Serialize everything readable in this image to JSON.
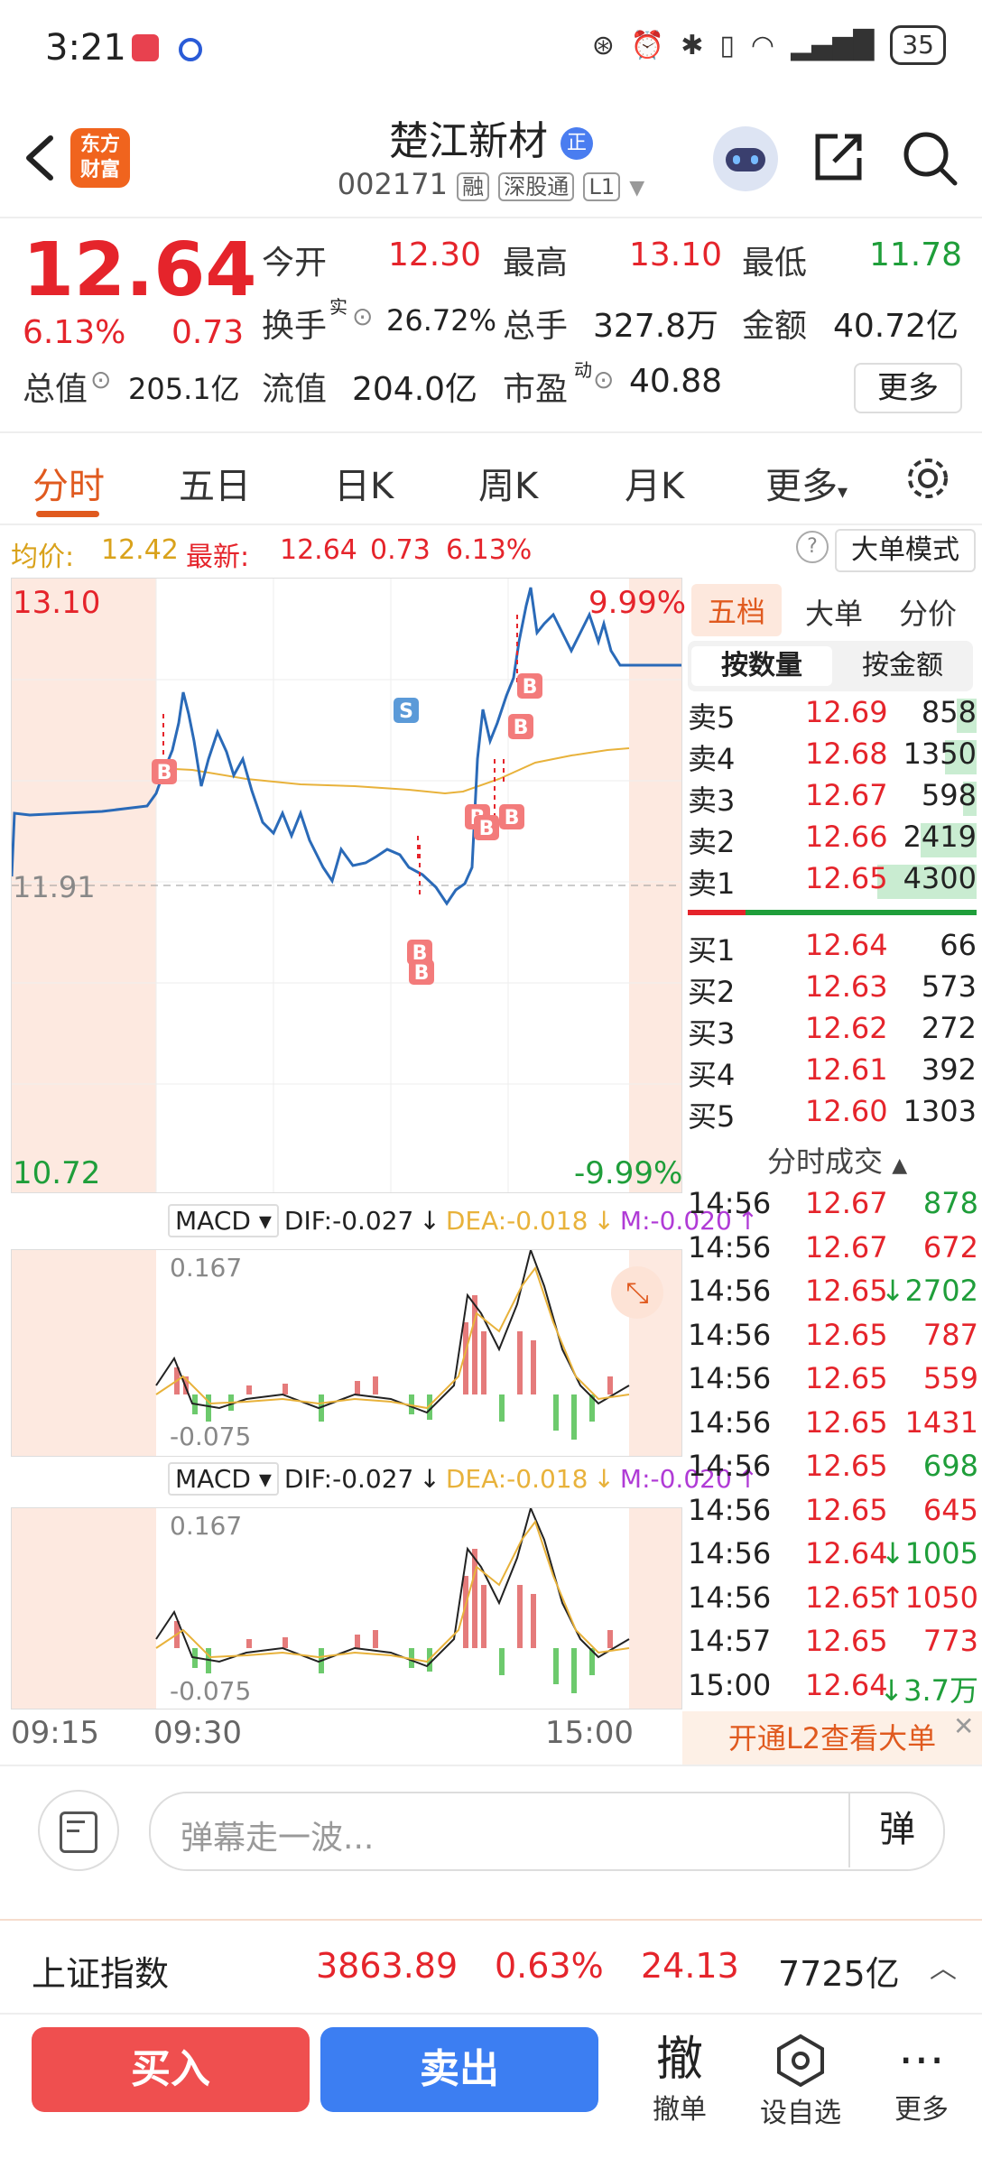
{
  "statusbar": {
    "time": "3:21",
    "battery": "35"
  },
  "header": {
    "logo_line1": "东方",
    "logo_line2": "财富",
    "stock_name": "楚江新材",
    "name_badge": "正",
    "code": "002171",
    "tags": [
      "融",
      "深股通",
      "L1"
    ]
  },
  "quote": {
    "price": "12.64",
    "change_pct": "6.13%",
    "change": "0.73",
    "open_label": "今开",
    "open": "12.30",
    "high_label": "最高",
    "high": "13.10",
    "low_label": "最低",
    "low": "11.78",
    "turnover_label": "换手",
    "turnover_sup": "实",
    "turnover": "26.72%",
    "volume_label": "总手",
    "volume": "327.8万",
    "amount_label": "金额",
    "amount": "40.72亿",
    "mktcap_label": "总值",
    "mktcap": "205.1亿",
    "float_label": "流值",
    "float": "204.0亿",
    "pe_label": "市盈",
    "pe_sup": "动",
    "pe": "40.88",
    "more": "更多"
  },
  "tabs": [
    "分时",
    "五日",
    "日K",
    "周K",
    "月K",
    "更多"
  ],
  "infobar": {
    "avg_label": "均价:",
    "avg": "12.42",
    "latest_label": "最新:",
    "latest": "12.64",
    "chg": "0.73",
    "pct": "6.13%",
    "help": "?",
    "bigmode": "大单模式"
  },
  "chart_labels": {
    "top_price": "13.10",
    "top_pct": "9.99%",
    "bottom_price": "10.72",
    "bottom_pct": "-9.99%",
    "ref_price": "11.91",
    "macd_name": "MACD",
    "dif": "DIF:-0.027",
    "dea": "DEA:-0.018",
    "m": "M:-0.020",
    "macd_max": "0.167",
    "macd_min": "-0.075",
    "time_ticks": [
      "09:15",
      "09:30",
      "15:00"
    ]
  },
  "right_panel": {
    "tabs": [
      "五档",
      "大单",
      "分价"
    ],
    "subtabs": [
      "按数量",
      "按金额"
    ],
    "asks": [
      {
        "name": "卖5",
        "price": "12.69",
        "vol": "858"
      },
      {
        "name": "卖4",
        "price": "12.68",
        "vol": "1350"
      },
      {
        "name": "卖3",
        "price": "12.67",
        "vol": "598"
      },
      {
        "name": "卖2",
        "price": "12.66",
        "vol": "2419"
      },
      {
        "name": "卖1",
        "price": "12.65",
        "vol": "4300"
      }
    ],
    "bids": [
      {
        "name": "买1",
        "price": "12.64",
        "vol": "66"
      },
      {
        "name": "买2",
        "price": "12.63",
        "vol": "573"
      },
      {
        "name": "买3",
        "price": "12.62",
        "vol": "272"
      },
      {
        "name": "买4",
        "price": "12.61",
        "vol": "392"
      },
      {
        "name": "买5",
        "price": "12.60",
        "vol": "1303"
      }
    ],
    "trades_title": "分时成交",
    "trades": [
      {
        "t": "14:56",
        "p": "12.67",
        "v": "878",
        "c": "green"
      },
      {
        "t": "14:56",
        "p": "12.67",
        "v": "672",
        "c": "red"
      },
      {
        "t": "14:56",
        "p": "12.65",
        "v": "↓2702",
        "c": "green"
      },
      {
        "t": "14:56",
        "p": "12.65",
        "v": "787",
        "c": "red"
      },
      {
        "t": "14:56",
        "p": "12.65",
        "v": "559",
        "c": "red"
      },
      {
        "t": "14:56",
        "p": "12.65",
        "v": "1431",
        "c": "red"
      },
      {
        "t": "14:56",
        "p": "12.65",
        "v": "698",
        "c": "green"
      },
      {
        "t": "14:56",
        "p": "12.65",
        "v": "645",
        "c": "red"
      },
      {
        "t": "14:56",
        "p": "12.64",
        "v": "↓1005",
        "c": "green"
      },
      {
        "t": "14:56",
        "p": "12.65",
        "v": "↑1050",
        "c": "red"
      },
      {
        "t": "14:57",
        "p": "12.65",
        "v": "773",
        "c": "red"
      },
      {
        "t": "15:00",
        "p": "12.64",
        "v": "↓3.7万",
        "c": "green"
      }
    ],
    "l2_banner": "开通L2查看大单"
  },
  "danmu": {
    "placeholder": "弹幕走一波...",
    "button": "弹"
  },
  "index": {
    "name": "上证指数",
    "value": "3863.89",
    "pct": "0.63%",
    "chg": "24.13",
    "amount": "7725亿"
  },
  "bottom": {
    "buy": "买入",
    "sell": "卖出",
    "cancel_glyph": "撤",
    "cancel": "撤单",
    "watch": "设自选",
    "more": "更多"
  },
  "colors": {
    "up": "#e5242b",
    "down": "#1f9e3a",
    "accent": "#e05a1f",
    "buy": "#ef4f4f",
    "sell": "#3c7ef2"
  }
}
